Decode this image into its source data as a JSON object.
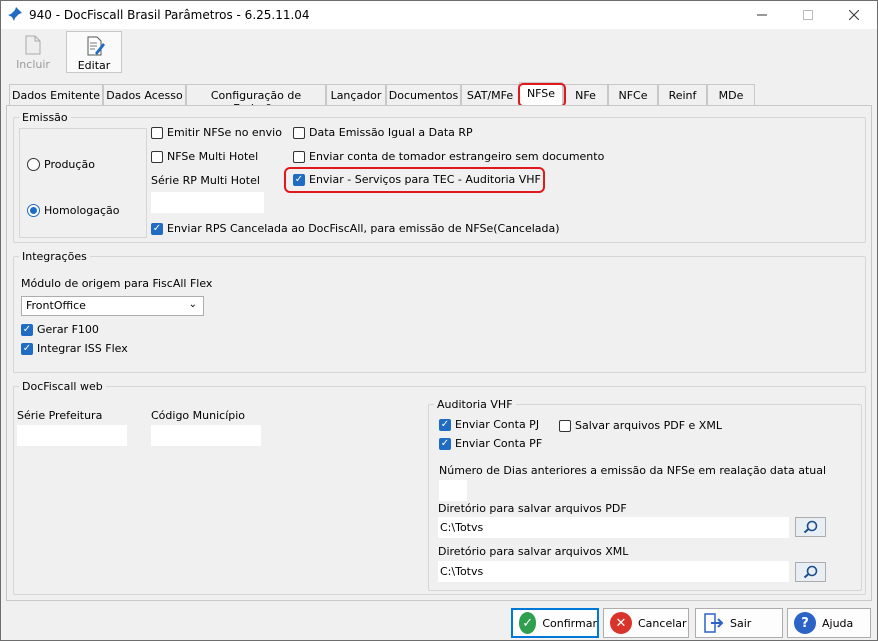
{
  "window": {
    "title": "940 - DocFiscall Brasil Parâmetros - 6.25.11.04"
  },
  "toolbar": {
    "incluir_label": "Incluir",
    "editar_label": "Editar"
  },
  "tabs": [
    {
      "label": "Dados Emitente"
    },
    {
      "label": "Dados Acesso"
    },
    {
      "label": "Configuração de Emissão"
    },
    {
      "label": "Lançador"
    },
    {
      "label": "Documentos"
    },
    {
      "label": "SAT/MFe"
    },
    {
      "label": "NFSe"
    },
    {
      "label": "NFe"
    },
    {
      "label": "NFCe"
    },
    {
      "label": "Reinf"
    },
    {
      "label": "MDe"
    }
  ],
  "emissao": {
    "legend": "Emissão",
    "radio_producao": "Produção",
    "radio_homologacao": "Homologação",
    "cb_emitir_nfse": "Emitir NFSe no envio",
    "cb_multi_hotel": "NFSe Multi Hotel",
    "serie_rp_label": "Série RP Multi Hotel",
    "serie_rp_value": "",
    "cb_data_emissao": "Data Emissão Igual a Data RP",
    "cb_tomador_estrangeiro": "Enviar conta de tomador estrangeiro sem documento",
    "cb_enviar_servicos_tec": "Enviar - Serviços para TEC - Auditoria VHF",
    "cb_rps_cancelada": "Enviar RPS Cancelada ao DocFiscAll, para emissão de NFSe(Cancelada)"
  },
  "integracoes": {
    "legend": "Integrações",
    "modulo_label": "Módulo de origem para FiscAll Flex",
    "modulo_value": "FrontOffice",
    "cb_gerar_f100": "Gerar F100",
    "cb_integrar_iss": "Integrar ISS Flex"
  },
  "docfiscall_web": {
    "legend": "DocFiscall web",
    "serie_prefeitura_label": "Série Prefeitura",
    "serie_prefeitura_value": "",
    "codigo_municipio_label": "Código Município",
    "codigo_municipio_value": ""
  },
  "auditoria": {
    "legend": "Auditoria VHF",
    "cb_conta_pj": "Enviar Conta PJ",
    "cb_conta_pf": "Enviar Conta PF",
    "cb_salvar_pdf_xml": "Salvar arquivos PDF e XML",
    "dias_label": "Número de Dias anteriores a emissão  da NFSe em realação  data  atual",
    "dias_value": "",
    "dir_pdf_label": "Diretório para salvar arquivos PDF",
    "dir_pdf_value": "C:\\Totvs",
    "dir_xml_label": "Diretório para salvar arquivos XML",
    "dir_xml_value": "C:\\Totvs"
  },
  "buttons": {
    "confirmar": "Confirmar",
    "cancelar": "Cancelar",
    "sair": "Sair",
    "ajuda": "Ajuda"
  },
  "colors": {
    "accent": "#1f6cc2",
    "highlight": "#e0191c",
    "confirm_green": "#2e9e4f",
    "cancel_red": "#d9342b",
    "help_blue": "#2b63c6"
  }
}
